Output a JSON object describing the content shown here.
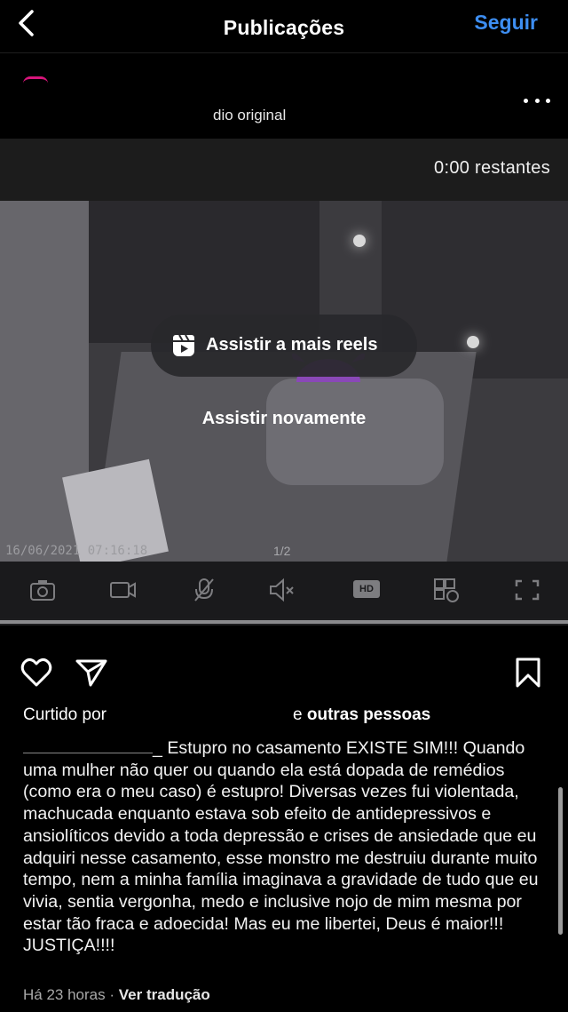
{
  "header": {
    "title": "Publicações",
    "follow_label": "Seguir"
  },
  "post": {
    "audio_label": "dio original",
    "more_icon": "more-icon"
  },
  "video": {
    "remaining": "0:00 restantes",
    "watch_more_reels": "Assistir a mais reels",
    "watch_again": "Assistir novamente",
    "camera_timestamp": "16/06/2021 07:16:18",
    "pager": "1/2",
    "hd_label": "HD",
    "camera_controls": [
      "camera-icon",
      "video-record-icon",
      "mic-muted-icon",
      "speaker-muted-icon",
      "hd-icon",
      "multiview-icon",
      "fullscreen-icon"
    ]
  },
  "actions": {
    "icons": [
      "heart-icon",
      "share-icon",
      "bookmark-icon"
    ]
  },
  "likes": {
    "prefix": "Curtido por",
    "suffix_plain": "e",
    "suffix_bold": "outras pessoas"
  },
  "caption": {
    "text": "_ Estupro no casamento EXISTE SIM!!! Quando uma mulher não quer ou quando ela está dopada de remédios (como era o meu caso) é estupro! Diversas vezes fui violentada, machucada enquanto estava sob efeito de antidepressivos e ansiolíticos devido a toda depressão e crises de ansiedade que eu adquiri nesse casamento, esse monstro me destruiu durante muito tempo, nem a minha família imaginava a gravidade de tudo que eu vivia, sentia vergonha, medo e inclusive nojo de mim mesma por estar tão fraca e adoecida! Mas eu me libertei, Deus é maior!!! JUSTIÇA!!!!"
  },
  "meta": {
    "time": "Há 23 horas",
    "separator": "·",
    "translate": "Ver tradução"
  }
}
